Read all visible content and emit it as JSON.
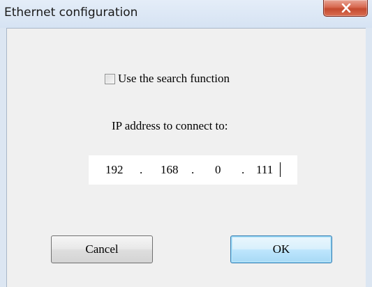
{
  "window": {
    "title": "Ethernet configuration"
  },
  "search": {
    "checkbox_label": "Use the search function",
    "checked": false
  },
  "ip": {
    "label": "IP address to connect to:",
    "octets": [
      "192",
      "168",
      "0",
      "111"
    ],
    "separator": "."
  },
  "buttons": {
    "cancel_label": "Cancel",
    "ok_label": "OK"
  },
  "icons": {
    "close": "close-icon"
  },
  "colors": {
    "title_bar": "#dce6f2",
    "close_button": "#c44a2f",
    "dialog_background": "#f0f0f0",
    "default_button_border": "#3c7fb1"
  }
}
